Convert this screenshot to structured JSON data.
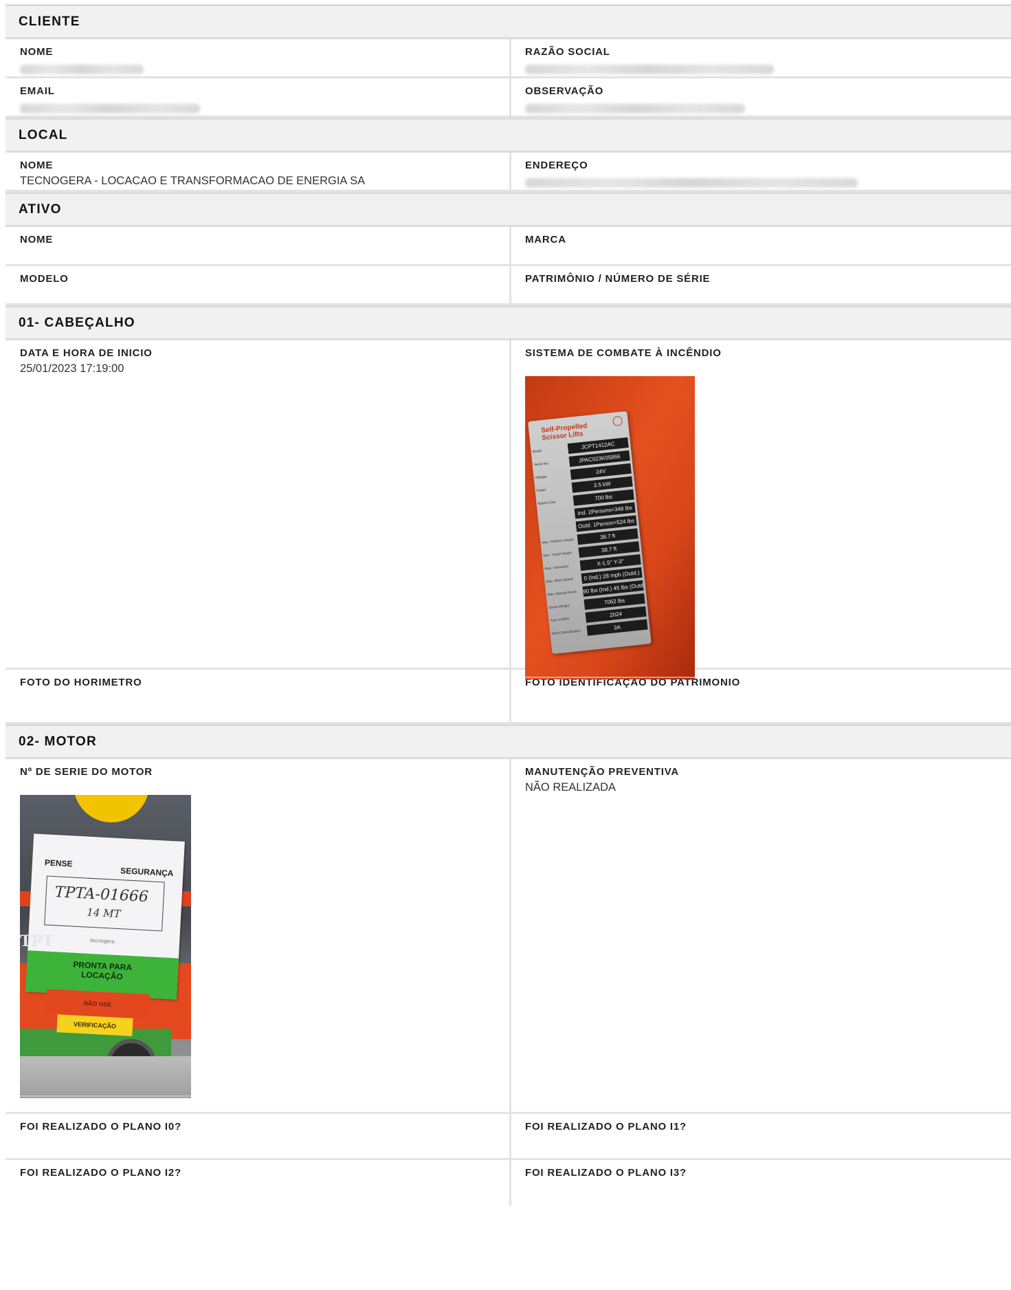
{
  "cliente": {
    "title": "CLIENTE",
    "nome_label": "NOME",
    "razao_label": "RAZÃO SOCIAL",
    "email_label": "EMAIL",
    "obs_label": "OBSERVAÇÃO"
  },
  "local": {
    "title": "LOCAL",
    "nome_label": "NOME",
    "nome_value": "TECNOGERA - LOCACAO E TRANSFORMACAO DE ENERGIA SA",
    "endereco_label": "ENDEREÇO"
  },
  "ativo": {
    "title": "ATIVO",
    "nome_label": "NOME",
    "marca_label": "MARCA",
    "modelo_label": "MODELO",
    "patrimonio_label": "PATRIMÔNIO / NÚMERO DE SÉRIE"
  },
  "cabecalho": {
    "title": "01- CABEÇALHO",
    "inicio_label": "DATA E HORA DE INICIO",
    "inicio_value": "25/01/2023 17:19:00",
    "incendio_label": "SISTEMA DE COMBATE À INCÊNDIO",
    "horimetro_label": "FOTO DO HORIMETRO",
    "ident_label": "FOTO IDENTIFICAÇÃO DO PATRIMONIO",
    "plate": {
      "heading1": "Self-Propelled",
      "heading2": "Scissor Lifts",
      "rows": [
        {
          "k": "Model",
          "v": "JCPT1412AC"
        },
        {
          "k": "Serial No.",
          "v": "JPAC023K05866"
        },
        {
          "k": "Voltage",
          "v": "24V"
        },
        {
          "k": "Power",
          "v": "3.5 kW"
        },
        {
          "k": "Rated Load",
          "v": "700 lbs"
        },
        {
          "k": "",
          "v": "Ind. 2Persons=348 lbs"
        },
        {
          "k": "",
          "v": "Outd. 1Person=524 lbs"
        },
        {
          "k": "Max. Platform Height",
          "v": "38.7 ft"
        },
        {
          "k": "Max. Travel Height",
          "v": "38.7 ft"
        },
        {
          "k": "Max. Inclination",
          "v": "X-1.5° Y-3°"
        },
        {
          "k": "Max. Wind Speed",
          "v": "0 (Ind.) 28 mph (Outd.)"
        },
        {
          "k": "Max. Manual Force",
          "v": "90 lbs (Ind.) 45 lbs (Outd.)"
        },
        {
          "k": "Gross Weight",
          "v": "7062 lbs"
        },
        {
          "k": "Year of MFG",
          "v": "2024"
        },
        {
          "k": "ANSI Classification",
          "v": "3A"
        }
      ]
    }
  },
  "motor": {
    "title": "02- MOTOR",
    "serie_label": "Nº DE SERIE DO MOTOR",
    "manut_label": "MANUTENÇÃO PREVENTIVA",
    "manut_value": "NÃO REALIZADA",
    "i0_label": "FOI REALIZADO O PLANO I0?",
    "i1_label": "FOI REALIZADO O PLANO I1?",
    "i2_label": "FOI REALIZADO O PLANO I2?",
    "i3_label": "FOI REALIZADO O PLANO I3?",
    "tag": {
      "pense": "PENSE",
      "seguranca": "SEGURANÇA",
      "hand1": "TPTA-01666",
      "hand2": "14 MT",
      "brand": "tecnogera",
      "pronta1": "PRONTA PARA",
      "pronta2": "LOCAÇÃO",
      "nao_use": "NÃO USE",
      "verificacao": "VERIFICAÇÃO",
      "side": "TPT"
    }
  }
}
